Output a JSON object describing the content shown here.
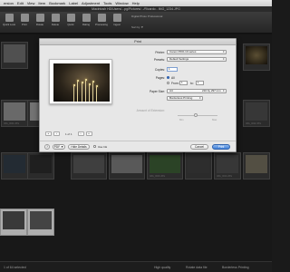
{
  "menubar": {
    "items": [
      "ersion",
      "Edit",
      "View",
      "Item",
      "Bookmark",
      "Label",
      "Adjustment",
      "Tools",
      "Window",
      "Help"
    ]
  },
  "window": {
    "title": "Macintosh HD/Users/...pg/Pictures/.../Ricardo - IMG_1234.JPG"
  },
  "toolbar": {
    "buttons": [
      {
        "label": "Quick Look",
        "icon": "eye-icon"
      },
      {
        "label": "Print",
        "icon": "printer-icon"
      },
      {
        "label": "Rotate",
        "icon": "rotate-icon"
      },
      {
        "label": "Delete",
        "icon": "trash-icon"
      },
      {
        "label": "Quick",
        "icon": "lightning-icon"
      },
      {
        "label": "Rating",
        "icon": "star-icon"
      },
      {
        "label": "Processing",
        "icon": "gear-icon"
      },
      {
        "label": "Ingest",
        "icon": "import-icon"
      }
    ],
    "status_text": "Digital Photo Professional",
    "sort_text": "Sort by ▼"
  },
  "dialog": {
    "title": "Print",
    "printer_label": "Printer:",
    "printer_value": "Canon PRO-10 series",
    "presets_label": "Presets:",
    "presets_value": "Default Settings",
    "copies_label": "Copies:",
    "copies_value": "1",
    "pages_label": "Pages:",
    "pages_all": "All",
    "pages_from": "From:",
    "pages_from_value": "1",
    "pages_to": "to:",
    "pages_to_value": "1",
    "paper_size_label": "Paper Size:",
    "paper_size_value": "A4",
    "paper_size_dims": "210 by 297 mm",
    "borderless": "Borderless Printing",
    "extension_label": "Amount of Extension:",
    "slider_min": "Min",
    "slider_max": "Max",
    "page_indicator": "1 of 1",
    "help_label": "?",
    "pdf_label": "PDF ▼",
    "hide_details": "Hide Details",
    "use_ink": "Use Ink",
    "cancel": "Cancel",
    "print": "Print"
  },
  "grid": {
    "captions": [
      "IMG_0001.JPG",
      "IMG_0002.JPG",
      "IMG_0003.JPG",
      "IMG_0004.JPG"
    ]
  },
  "statusbar": {
    "left": "1 of 64 selected",
    "middle": "High quality",
    "right1": "Rotate data file",
    "right2": "Borderless Printing"
  },
  "colors": {
    "accent": "#3f7fd8",
    "dialog_bg": "#e7e7e7",
    "app_bg": "#202020"
  }
}
